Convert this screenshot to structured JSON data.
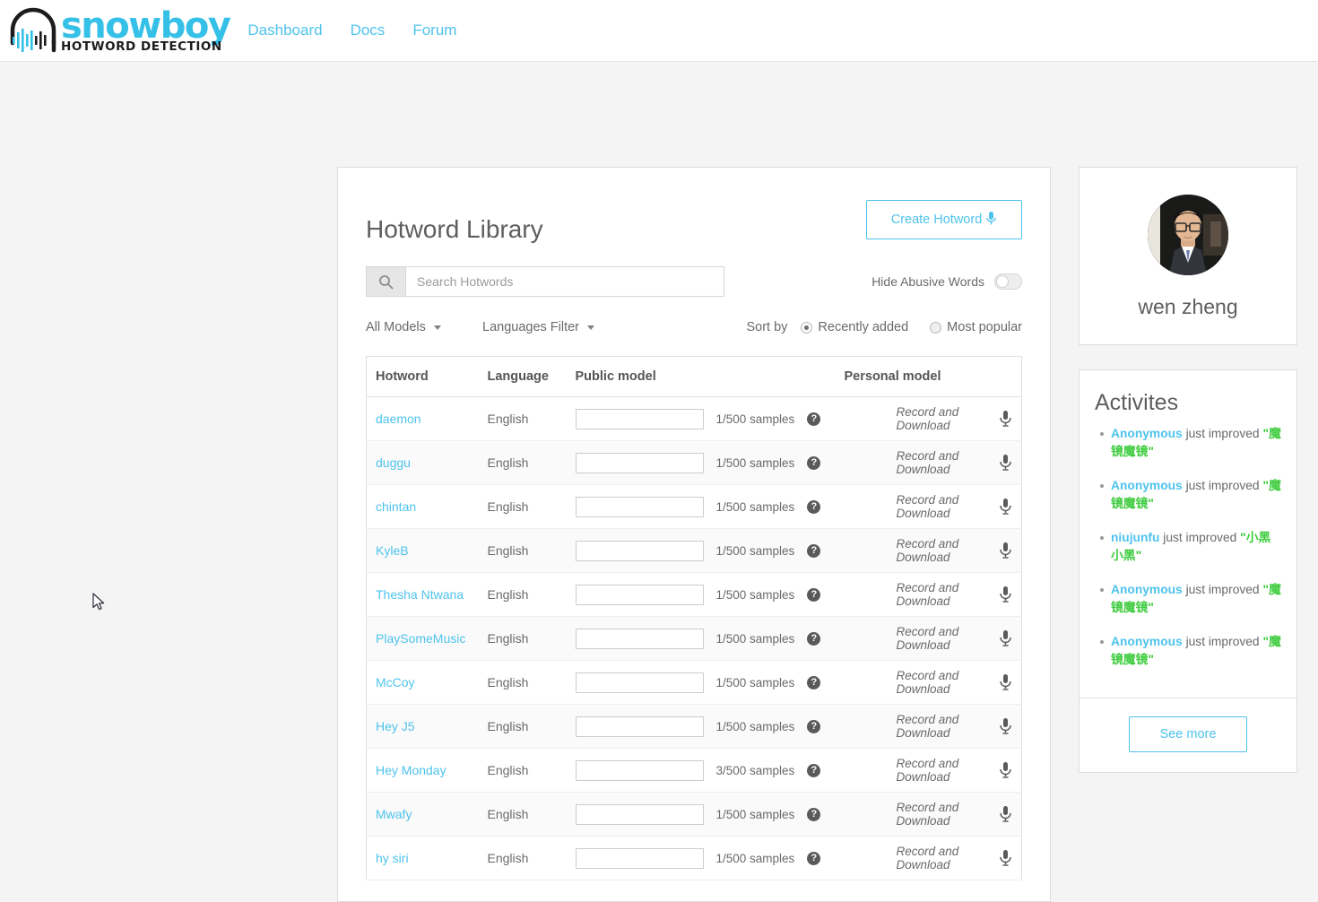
{
  "navbar": {
    "logo_word": "snowboy",
    "logo_tagline": "HOTWORD DETECTION",
    "links": [
      {
        "label": "Dashboard"
      },
      {
        "label": "Docs"
      },
      {
        "label": "Forum"
      }
    ]
  },
  "main": {
    "title": "Hotword Library",
    "create_button": "Create Hotword",
    "create_button_icon": "microphone-icon",
    "search": {
      "placeholder": "Search Hotwords",
      "value": "",
      "icon": "search-icon"
    },
    "abusive": {
      "label": "Hide Abusive Words",
      "state": "off"
    },
    "filters": {
      "models": "All Models",
      "languages": "Languages Filter"
    },
    "sort": {
      "label": "Sort by",
      "options": [
        {
          "label": "Recently added",
          "selected": true
        },
        {
          "label": "Most popular",
          "selected": false
        }
      ]
    },
    "table": {
      "columns": [
        "Hotword",
        "Language",
        "Public model",
        "Personal model"
      ],
      "record_link": "Record and Download",
      "help_icon": "help-icon",
      "mic_icon": "microphone-icon",
      "rows": [
        {
          "hotword": "daemon",
          "language": "English",
          "samples": "1/500 samples"
        },
        {
          "hotword": "duggu",
          "language": "English",
          "samples": "1/500 samples"
        },
        {
          "hotword": "chintan",
          "language": "English",
          "samples": "1/500 samples"
        },
        {
          "hotword": "KyleB",
          "language": "English",
          "samples": "1/500 samples"
        },
        {
          "hotword": "Thesha Ntwana",
          "language": "English",
          "samples": "1/500 samples"
        },
        {
          "hotword": "PlaySomeMusic",
          "language": "English",
          "samples": "1/500 samples"
        },
        {
          "hotword": "McCoy",
          "language": "English",
          "samples": "1/500 samples"
        },
        {
          "hotword": "Hey J5",
          "language": "English",
          "samples": "1/500 samples"
        },
        {
          "hotword": "Hey Monday",
          "language": "English",
          "samples": "3/500 samples"
        },
        {
          "hotword": "Mwafy",
          "language": "English",
          "samples": "1/500 samples"
        },
        {
          "hotword": "hy siri",
          "language": "English",
          "samples": "1/500 samples"
        }
      ]
    }
  },
  "sidebar": {
    "profile": {
      "name": "wen zheng",
      "avatar": "user-avatar"
    },
    "activities": {
      "title": "Activites",
      "items": [
        {
          "user": "Anonymous",
          "action": "just improved",
          "hotword": "\"魔镜魔镜\""
        },
        {
          "user": "Anonymous",
          "action": "just improved",
          "hotword": "\"魔镜魔镜\""
        },
        {
          "user": "niujunfu",
          "action": "just improved",
          "hotword": "\"小黑 小黑\""
        },
        {
          "user": "Anonymous",
          "action": "just improved",
          "hotword": "\"魔镜魔镜\""
        },
        {
          "user": "Anonymous",
          "action": "just improved",
          "hotword": "\"魔镜魔镜\""
        }
      ],
      "see_more": "See more"
    }
  },
  "colors": {
    "brand": "#4ec3ed",
    "logo": "#35c0e8",
    "hotword_green": "#3fcc3f",
    "page_bg": "#f4f4f4"
  }
}
